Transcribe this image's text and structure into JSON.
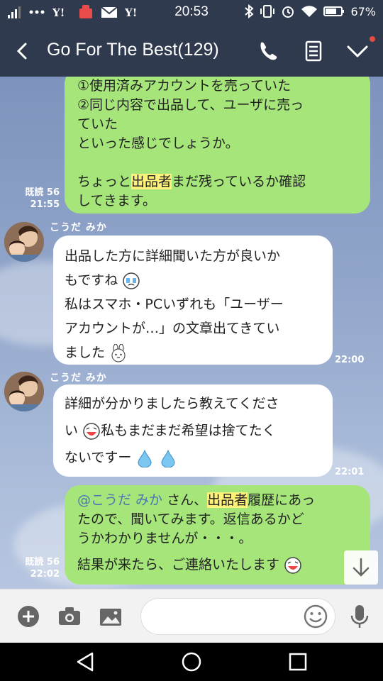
{
  "status_bar": {
    "time": "20:53",
    "battery": "67%",
    "left_icons": [
      "signal-icon",
      "dots-icon",
      "yahoo-icon",
      "app-icon",
      "mail-icon",
      "yahoo-icon"
    ],
    "right_icons": [
      "bluetooth-icon",
      "vibrate-icon",
      "alarm-icon",
      "wifi-icon",
      "battery-icon"
    ]
  },
  "header": {
    "title": "Go For The Best(129)",
    "icons": [
      "back-icon",
      "phone-icon",
      "notes-icon",
      "chevron-down-icon"
    ],
    "notification_color": "#e74c3c"
  },
  "messages": [
    {
      "side": "me",
      "lines": [
        "①使用済みアカウントを売っていた",
        "②同じ内容で出品して、ユーザに売っ",
        "ていた",
        "といった感じでしょうか。",
        "",
        "ちょっと",
        "出品者",
        "まだ残っているか確認",
        "してきます。"
      ],
      "read": "既読 56",
      "time": "21:55"
    },
    {
      "side": "them",
      "sender": "こうだ みか",
      "lines": [
        "出品した方に詳細聞いた方が良いか",
        "もですね",
        "私はスマホ・PCいずれも「ユーザー",
        "アカウントが…」の文章出てきてい",
        "ました"
      ],
      "time": "22:00"
    },
    {
      "side": "them",
      "sender": "こうだ みか",
      "lines": [
        "詳細が分かりましたら教えてくださ",
        "い",
        "私もまだまだ希望は捨てたく",
        "ないですー"
      ],
      "time": "22:01"
    },
    {
      "side": "me",
      "mention": "@こうだ みか",
      "lines": [
        " さん、",
        "出品者",
        "履歴にあっ",
        "たので、聞いてみます。返信あるかど",
        "うかわかりませんが・・・。",
        "結果が来たら、ご連絡いたします"
      ],
      "read": "既読 56",
      "time": "22:02"
    }
  ],
  "input_bar": {
    "placeholder": "",
    "icons": [
      "plus-icon",
      "camera-icon",
      "image-icon",
      "emoji-icon",
      "microphone-icon"
    ]
  },
  "nav_bar": {
    "icons": [
      "back-triangle-icon",
      "home-circle-icon",
      "recents-square-icon"
    ]
  },
  "colors": {
    "header_bg": "#2f3a4f",
    "my_bubble": "#a5e57a",
    "their_bubble": "#ffffff",
    "highlight": "#fff27a",
    "mention": "#4a76b6"
  }
}
